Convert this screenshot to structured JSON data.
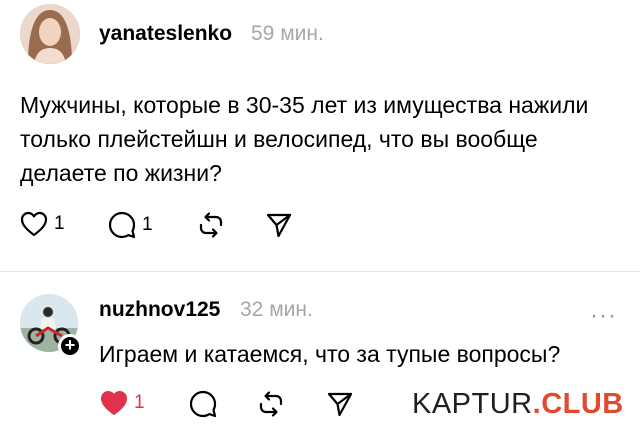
{
  "colors": {
    "accent_like": "#e0324b",
    "watermark_red": "#e24a30",
    "muted": "#a7a7a7"
  },
  "post1": {
    "username": "yanateslenko",
    "time": "59 мин.",
    "text": "Мужчины, которые в 30-35 лет из имущества нажили только плейстейшн и велосипед, что вы вообще делаете по жизни?",
    "likes": "1",
    "replies": "1",
    "icons": [
      "heart-outline-icon",
      "comment-icon",
      "repost-icon",
      "share-icon"
    ]
  },
  "post2": {
    "username": "nuzhnov125",
    "time": "32 мин.",
    "text": "Играем и катаемся, что за тупые вопросы?",
    "likes": "1",
    "follow_glyph": "+",
    "more_glyph": "···",
    "icons": [
      "heart-filled-icon",
      "comment-icon",
      "repost-icon",
      "share-icon"
    ]
  },
  "watermark": {
    "part1": "KAPTUR",
    "part2": ".CLUB"
  }
}
